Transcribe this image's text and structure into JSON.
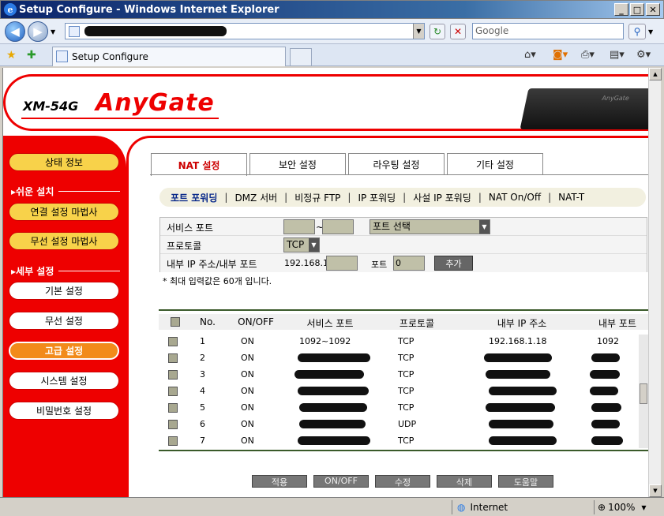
{
  "window": {
    "title": "Setup Configure - Windows Internet Explorer",
    "min": "_",
    "max": "□",
    "close": "✕"
  },
  "browser": {
    "search_placeholder": "Google",
    "tab_title": "Setup Configure",
    "status_zone": "Internet",
    "zoom": "100%"
  },
  "header": {
    "model": "XM-54G",
    "brand": "AnyGate",
    "router_label": "AnyGate"
  },
  "sidebar": {
    "status": "상태 정보",
    "easy_head": "▸쉬운 설치",
    "wizard_conn": "연결 설정 마법사",
    "wizard_wireless": "무선 설정 마법사",
    "detail_head": "▸세부 설정",
    "basic": "기본 설정",
    "wireless": "무선 설정",
    "advanced": "고급 설정",
    "system": "시스템 설정",
    "password": "비밀번호 설정"
  },
  "tabs": [
    "NAT 설정",
    "보안 설정",
    "라우팅 설정",
    "기타 설정"
  ],
  "subnav": [
    "포트 포워딩",
    "DMZ 서버",
    "비정규 FTP",
    "IP 포워딩",
    "사설 IP 포워딩",
    "NAT On/Off",
    "NAT-T"
  ],
  "form": {
    "service_port_label": "서비스 포트",
    "tilde": "~",
    "port_select": "포트 선택",
    "protocol_label": "프로토콜",
    "protocol_value": "TCP",
    "ip_label": "내부 IP 주소/내부 포트",
    "ip_prefix": "192.168.1.",
    "port_label": "포트",
    "port_value": "0",
    "add_button": "추가",
    "note": "* 최대 입력값은 60개 입니다."
  },
  "table": {
    "headers": [
      "No.",
      "ON/OFF",
      "서비스 포트",
      "프로토콜",
      "내부 IP 주소",
      "내부 포트"
    ],
    "rows": [
      {
        "no": "1",
        "state": "ON",
        "service": "1092~1092",
        "proto": "TCP",
        "ip": "192.168.1.18",
        "port": "1092"
      },
      {
        "no": "2",
        "state": "ON",
        "service": "",
        "proto": "TCP",
        "ip": "",
        "port": ""
      },
      {
        "no": "3",
        "state": "ON",
        "service": "",
        "proto": "TCP",
        "ip": "",
        "port": ""
      },
      {
        "no": "4",
        "state": "ON",
        "service": "",
        "proto": "TCP",
        "ip": "",
        "port": ""
      },
      {
        "no": "5",
        "state": "ON",
        "service": "",
        "proto": "TCP",
        "ip": "",
        "port": ""
      },
      {
        "no": "6",
        "state": "ON",
        "service": "",
        "proto": "UDP",
        "ip": "",
        "port": ""
      },
      {
        "no": "7",
        "state": "ON",
        "service": "",
        "proto": "TCP",
        "ip": "",
        "port": ""
      }
    ]
  },
  "bottom_buttons": [
    "적용",
    "ON/OFF",
    "수정",
    "삭제",
    "도움말"
  ]
}
